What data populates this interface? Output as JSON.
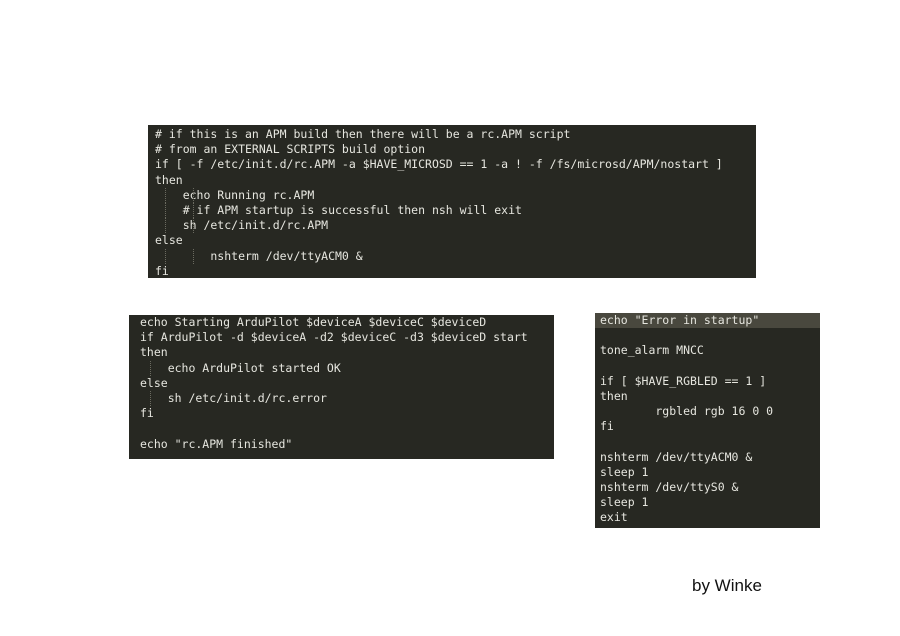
{
  "panels": [
    {
      "lines": [
        "# if this is an APM build then there will be a rc.APM script",
        "# from an EXTERNAL SCRIPTS build option",
        "if [ -f /etc/init.d/rc.APM -a $HAVE_MICROSD == 1 -a ! -f /fs/microsd/APM/nostart ]",
        "then",
        "    echo Running rc.APM",
        "    # if APM startup is successful then nsh will exit",
        "    sh /etc/init.d/rc.APM",
        "else",
        "        nshterm /dev/ttyACM0 &",
        "fi"
      ]
    },
    {
      "lines": [
        "echo Starting ArduPilot $deviceA $deviceC $deviceD",
        "if ArduPilot -d $deviceA -d2 $deviceC -d3 $deviceD start",
        "then",
        "    echo ArduPilot started OK",
        "else",
        "    sh /etc/init.d/rc.error",
        "fi",
        "",
        "echo \"rc.APM finished\""
      ]
    },
    {
      "lines": [
        "echo \"Error in startup\"",
        "",
        "tone_alarm MNCC",
        "",
        "if [ $HAVE_RGBLED == 1 ]",
        "then",
        "        rgbled rgb 16 0 0",
        "fi",
        "",
        "nshterm /dev/ttyACM0 &",
        "sleep 1",
        "nshterm /dev/ttyS0 &",
        "sleep 1",
        "exit"
      ]
    }
  ],
  "signature": "by Winke",
  "colors": {
    "editor_background": "#272822",
    "editor_text": "#e6e6df",
    "current_line": "#49483e",
    "page_background": "#ffffff"
  }
}
